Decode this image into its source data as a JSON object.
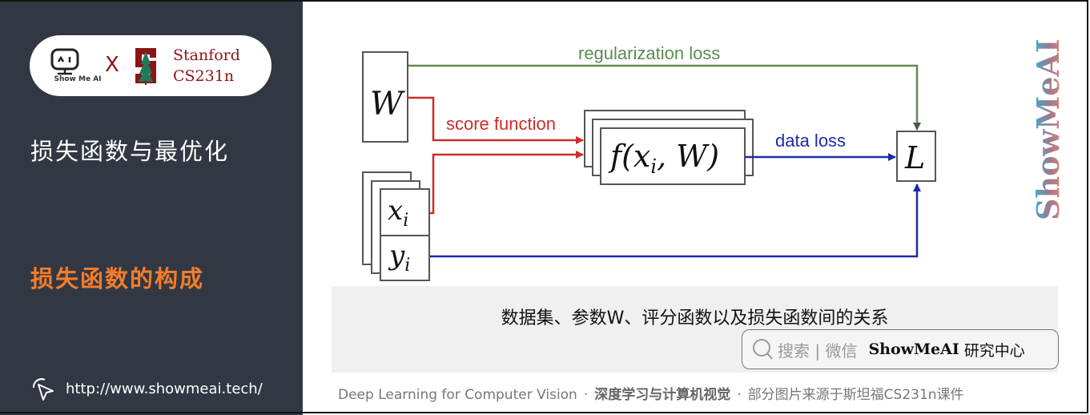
{
  "sidebar": {
    "logo": {
      "showmeai_label": "Show Me AI",
      "separator": "X",
      "stanford_line1": "Stanford",
      "stanford_line2": "CS231n"
    },
    "course_title": "损失函数与最优化",
    "section_title": "损失函数的构成",
    "url": "http://www.showmeai.tech/"
  },
  "diagram": {
    "nodes": {
      "W": "W",
      "L": "L",
      "xi_base": "x",
      "yi_base": "y",
      "subscript": "i",
      "f_label": "f(x",
      "f_tail": ", W)"
    },
    "labels": {
      "regularization_loss": "regularization loss",
      "score_function": "score function",
      "data_loss": "data loss"
    },
    "colors": {
      "regularization": "#5f8a55",
      "score": "#d12a2a",
      "data": "#1f2aa8"
    }
  },
  "watermark": {
    "text": "ShowMeAI"
  },
  "caption": {
    "text": "数据集、参数W、评分函数以及损失函数间的关系",
    "search_hint": "搜索 | 微信",
    "search_brand": "ShowMeAI",
    "search_brand_suffix": "研究中心"
  },
  "footer": {
    "course_en": "Deep Learning for Computer Vision",
    "separator": "·",
    "course_cn": "深度学习与计算机视觉",
    "credit": "部分图片来源于斯坦福CS231n课件"
  },
  "colors": {
    "sidebar_bg": "#323843",
    "accent_orange": "#f47c2a",
    "stanford_red": "#8c1515"
  }
}
